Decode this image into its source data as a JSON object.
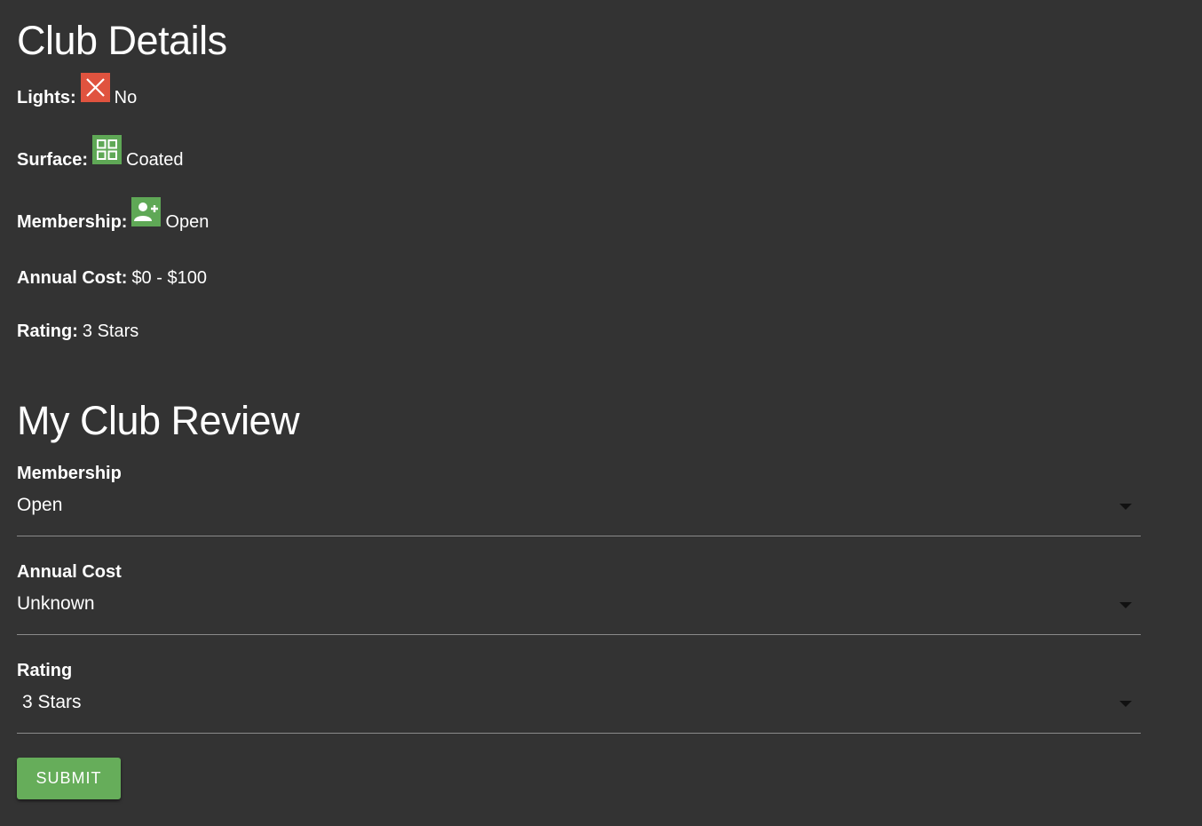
{
  "details": {
    "title": "Club Details",
    "lights": {
      "label": "Lights:",
      "value": "No",
      "icon": "close-icon",
      "icon_color": "#e0533f"
    },
    "surface": {
      "label": "Surface:",
      "value": "Coated",
      "icon": "grid-icon",
      "icon_color": "#5fa856"
    },
    "membership": {
      "label": "Membership:",
      "value": "Open",
      "icon": "person-add-icon",
      "icon_color": "#5fa856"
    },
    "annual_cost": {
      "label": "Annual Cost:",
      "value": "$0 - $100"
    },
    "rating": {
      "label": "Rating:",
      "value": "3 Stars"
    }
  },
  "review": {
    "title": "My Club Review",
    "membership": {
      "label": "Membership",
      "selected": "Open"
    },
    "annual_cost": {
      "label": "Annual Cost",
      "selected": "Unknown"
    },
    "rating": {
      "label": "Rating",
      "selected": "3 Stars"
    },
    "submit_label": "SUBMIT"
  },
  "colors": {
    "background": "#333333",
    "accent_green": "#66ad5a",
    "error_red": "#e0533f"
  }
}
